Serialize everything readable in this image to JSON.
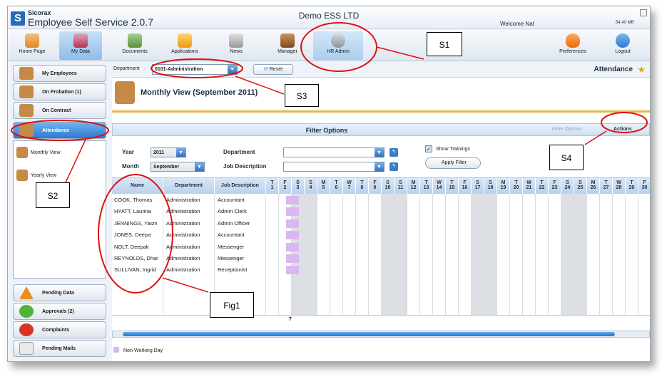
{
  "app": {
    "brand": "Sicorax",
    "title": "Employee Self Service 2.0.7",
    "company": "Demo ESS LTD",
    "welcome": "Welcome Nat",
    "memory": "54.40 MB",
    "logo_letter": "S"
  },
  "nav": [
    {
      "label": "Home Page",
      "icon": "home-icon"
    },
    {
      "label": "My Data",
      "icon": "my-data-icon",
      "active": true
    },
    {
      "label": "Documents",
      "icon": "documents-icon"
    },
    {
      "label": "Applications",
      "icon": "applications-icon"
    },
    {
      "label": "News",
      "icon": "news-icon"
    },
    {
      "label": "Manager",
      "icon": "manager-icon"
    },
    {
      "label": "HR Admin",
      "icon": "gears-icon"
    },
    {
      "label": "Preferences",
      "icon": "heart-icon"
    },
    {
      "label": "Logout",
      "icon": "power-icon"
    }
  ],
  "sidebar": {
    "top": [
      {
        "label": "My Employees"
      },
      {
        "label": "On Probation (1)"
      },
      {
        "label": "On Contract"
      },
      {
        "label": "Attendance",
        "active": true
      }
    ],
    "sub": [
      {
        "label": "Monthly View"
      },
      {
        "label": "Yearly View"
      }
    ],
    "bottom": [
      {
        "label": "Pending Data"
      },
      {
        "label": "Approvals (2)"
      },
      {
        "label": "Complaints"
      },
      {
        "label": "Pending Mails"
      }
    ]
  },
  "dept": {
    "label": "Department",
    "value": "0101-Administration",
    "reset": "Reset",
    "arrow": "▼",
    "page_title": "Attendance",
    "star": "★"
  },
  "view": {
    "title": "Monthly View  (September 2011)"
  },
  "filter": {
    "title": "Filter Options",
    "options_tab": "Filter Options",
    "actions_tab": "Actions",
    "year_label": "Year",
    "year": "2011",
    "month_label": "Month",
    "month": "September",
    "department_label": "Department",
    "department": "",
    "jobdesc_label": "Job Description",
    "jobdesc": "",
    "show_trainings": "Show Trainings",
    "apply": "Apply Filter"
  },
  "grid": {
    "headers": {
      "name": "Name",
      "department": "Department",
      "job": "Job Description"
    },
    "days": [
      {
        "d": "T",
        "n": "1"
      },
      {
        "d": "F",
        "n": "2"
      },
      {
        "d": "S",
        "n": "3"
      },
      {
        "d": "S",
        "n": "4"
      },
      {
        "d": "M",
        "n": "5"
      },
      {
        "d": "T",
        "n": "6"
      },
      {
        "d": "W",
        "n": "7"
      },
      {
        "d": "T",
        "n": "8"
      },
      {
        "d": "F",
        "n": "9"
      },
      {
        "d": "S",
        "n": "10"
      },
      {
        "d": "S",
        "n": "11"
      },
      {
        "d": "M",
        "n": "12"
      },
      {
        "d": "T",
        "n": "13"
      },
      {
        "d": "W",
        "n": "14"
      },
      {
        "d": "T",
        "n": "15"
      },
      {
        "d": "F",
        "n": "16"
      },
      {
        "d": "S",
        "n": "17"
      },
      {
        "d": "S",
        "n": "18"
      },
      {
        "d": "M",
        "n": "19"
      },
      {
        "d": "T",
        "n": "20"
      },
      {
        "d": "W",
        "n": "21"
      },
      {
        "d": "T",
        "n": "22"
      },
      {
        "d": "F",
        "n": "23"
      },
      {
        "d": "S",
        "n": "24"
      },
      {
        "d": "S",
        "n": "25"
      },
      {
        "d": "M",
        "n": "26"
      },
      {
        "d": "T",
        "n": "27"
      },
      {
        "d": "W",
        "n": "28"
      },
      {
        "d": "T",
        "n": "29"
      },
      {
        "d": "F",
        "n": "30"
      }
    ],
    "rows": [
      {
        "name": "COOK, Thomas",
        "department": "Administration",
        "job": "Accountant"
      },
      {
        "name": "HYATT, Laurina",
        "department": "Administration",
        "job": "Admin Clerk"
      },
      {
        "name": "JENNINGS, Yasm",
        "department": "Administration",
        "job": "Admin Officer"
      },
      {
        "name": "JONES, Deepa",
        "department": "Administration",
        "job": "Accountant"
      },
      {
        "name": "NOLT, Deepak",
        "department": "Administration",
        "job": "Messenger"
      },
      {
        "name": "REYNOLDS, Dhar",
        "department": "Administration",
        "job": "Messenger"
      },
      {
        "name": "SULLIVAN, Ingrid",
        "department": "Administration",
        "job": "Receptionist"
      }
    ],
    "total": "7"
  },
  "legend": {
    "non_working": "Non-Working Day"
  },
  "callouts": {
    "s1": "S1",
    "s2": "S2",
    "s3": "S3",
    "s4": "S4",
    "fig1": "Fig1"
  },
  "colors": {
    "accent": "#2c78cf",
    "non_working": "#d9b8f0",
    "annotation": "#e01010",
    "weekend": "#dcdfe3"
  }
}
